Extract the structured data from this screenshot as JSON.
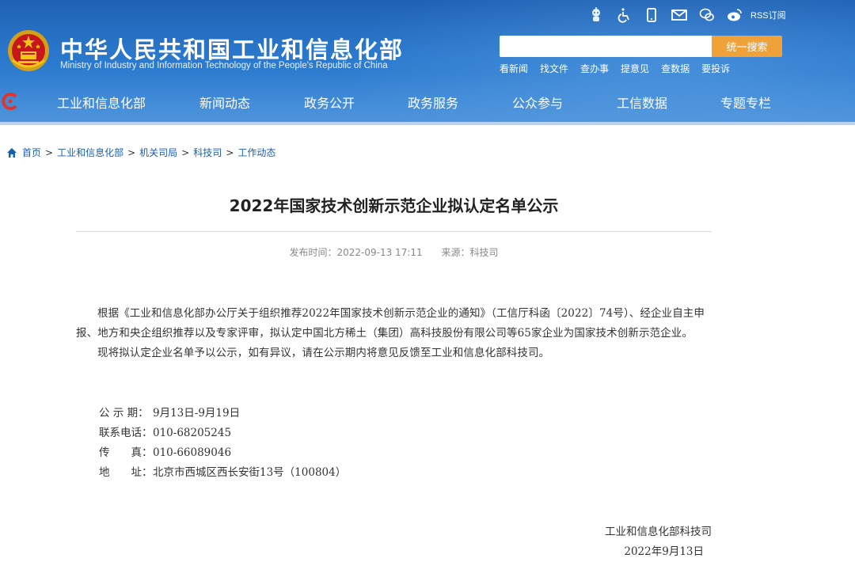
{
  "header": {
    "site_title": "中华人民共和国工业和信息化部",
    "site_subtitle": "Ministry of Industry and Information Technology of the People's Republic of China",
    "util_icons": [
      "robot-assistant-icon",
      "accessibility-icon",
      "mobile-icon",
      "mail-icon",
      "wechat-icon",
      "weibo-icon"
    ],
    "rss_label": "RSS订阅",
    "search": {
      "placeholder": "",
      "button_label": "统一搜索"
    },
    "quick_links": [
      "看新闻",
      "找文件",
      "查办事",
      "提意见",
      "查数据",
      "要投诉"
    ],
    "colors": {
      "header_blue": "#2a78cc",
      "search_button": "#f0a23a"
    }
  },
  "nav": {
    "items": [
      "工业和信息化部",
      "新闻动态",
      "政务公开",
      "政务服务",
      "公众参与",
      "工信数据",
      "专题专栏"
    ]
  },
  "breadcrumb": [
    "首页",
    "工业和信息化部",
    "机关司局",
    "科技司",
    "工作动态"
  ],
  "article": {
    "title": "2022年国家技术创新示范企业拟认定名单公示",
    "publish_time": "发布时间：2022-09-13 17:11",
    "source": "来源：科技司",
    "paragraphs": [
      "根据《工业和信息化部办公厅关于组织推荐2022年国家技术创新示范企业的通知》（工信厅科函〔2022〕74号）、经企业自主申报、地方和央企组织推荐以及专家评审，拟认定中国北方稀土（集团）高科技股份有限公司等65家企业为国家技术创新示范企业。",
      "现将拟认定企业名单予以公示，如有异议，请在公示期内将意见反馈至工业和信息化部科技司。"
    ],
    "info": [
      {
        "label": "公 示 期：",
        "value": "9月13日-9月19日"
      },
      {
        "label": "联系电话：",
        "value": "010-68205245"
      },
      {
        "label": "传　　真：",
        "value": "010-66089046"
      },
      {
        "label": "地　　址：",
        "value": "北京市西城区西长安街13号（100804）"
      }
    ],
    "signature": {
      "org": "工业和信息化部科技司",
      "date": "2022年9月13日"
    }
  }
}
